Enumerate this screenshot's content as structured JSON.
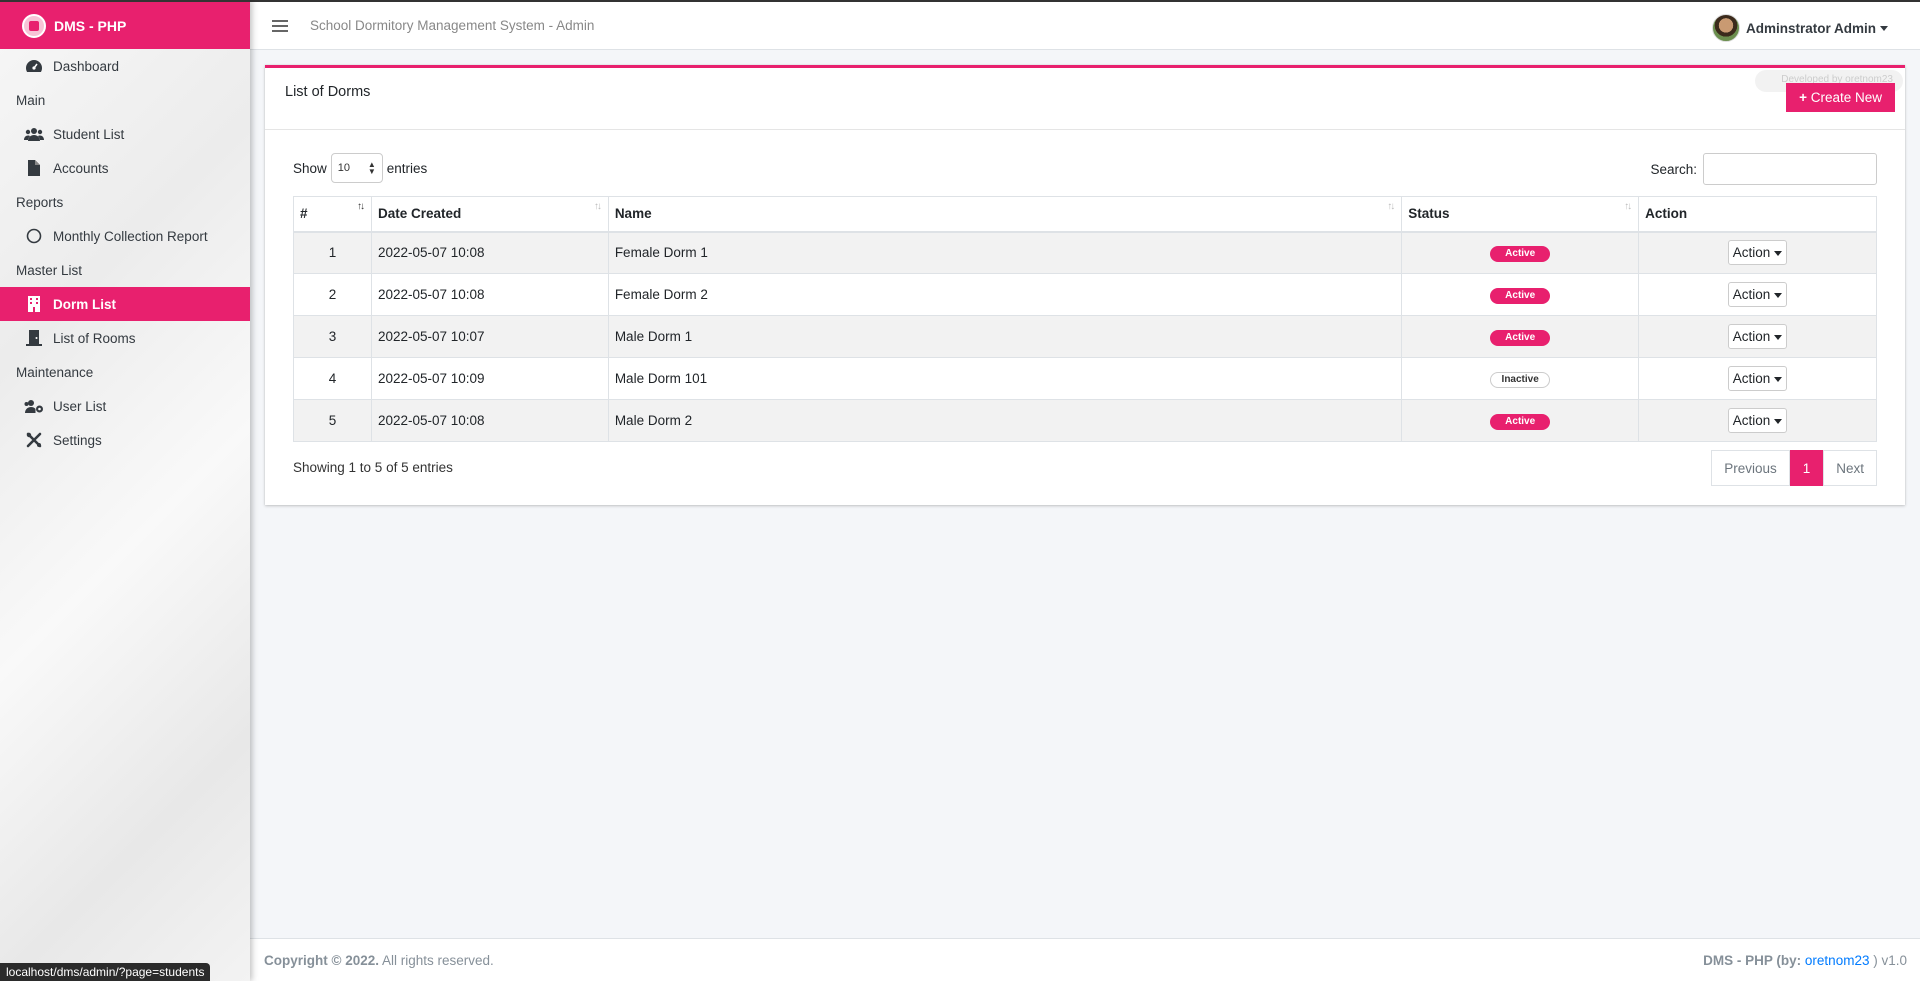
{
  "brand": {
    "name": "DMS - PHP"
  },
  "sidebar": {
    "dashboard": "Dashboard",
    "sections": {
      "main": "Main",
      "reports": "Reports",
      "master": "Master List",
      "maintenance": "Maintenance"
    },
    "items": {
      "student_list": "Student List",
      "accounts": "Accounts",
      "monthly_report": "Monthly Collection Report",
      "dorm_list": "Dorm List",
      "list_of_rooms": "List of Rooms",
      "user_list": "User List",
      "settings": "Settings"
    },
    "active_item": "Dorm List"
  },
  "status_url": "localhost/dms/admin/?page=students",
  "topbar": {
    "title": "School Dormitory Management System - Admin",
    "user": "Adminstrator Admin"
  },
  "card": {
    "title": "List of Dorms",
    "create_label": "Create New",
    "credit": "Developed by oretnom23"
  },
  "controls": {
    "show": "Show",
    "entries_value": "10",
    "entries": "entries",
    "search_label": "Search:"
  },
  "table": {
    "headers": [
      "#",
      "Date Created",
      "Name",
      "Status",
      "Action"
    ],
    "rows": [
      {
        "num": "1",
        "date": "2022-05-07 10:08",
        "name": "Female Dorm 1",
        "status": "Active",
        "action": "Action"
      },
      {
        "num": "2",
        "date": "2022-05-07 10:08",
        "name": "Female Dorm 2",
        "status": "Active",
        "action": "Action"
      },
      {
        "num": "3",
        "date": "2022-05-07 10:07",
        "name": "Male Dorm 1",
        "status": "Active",
        "action": "Action"
      },
      {
        "num": "4",
        "date": "2022-05-07 10:09",
        "name": "Male Dorm 101",
        "status": "Inactive",
        "action": "Action"
      },
      {
        "num": "5",
        "date": "2022-05-07 10:08",
        "name": "Male Dorm 2",
        "status": "Active",
        "action": "Action"
      }
    ]
  },
  "pagination": {
    "info": "Showing 1 to 5 of 5 entries",
    "previous": "Previous",
    "current": "1",
    "next": "Next"
  },
  "footer": {
    "copyright": "Copyright © 2022.",
    "rights": "All rights reserved.",
    "right_prefix": "DMS - PHP (by:",
    "author": "oretnom23",
    "right_suffix": ") v1.0"
  },
  "colors": {
    "accent": "#e8206e"
  }
}
